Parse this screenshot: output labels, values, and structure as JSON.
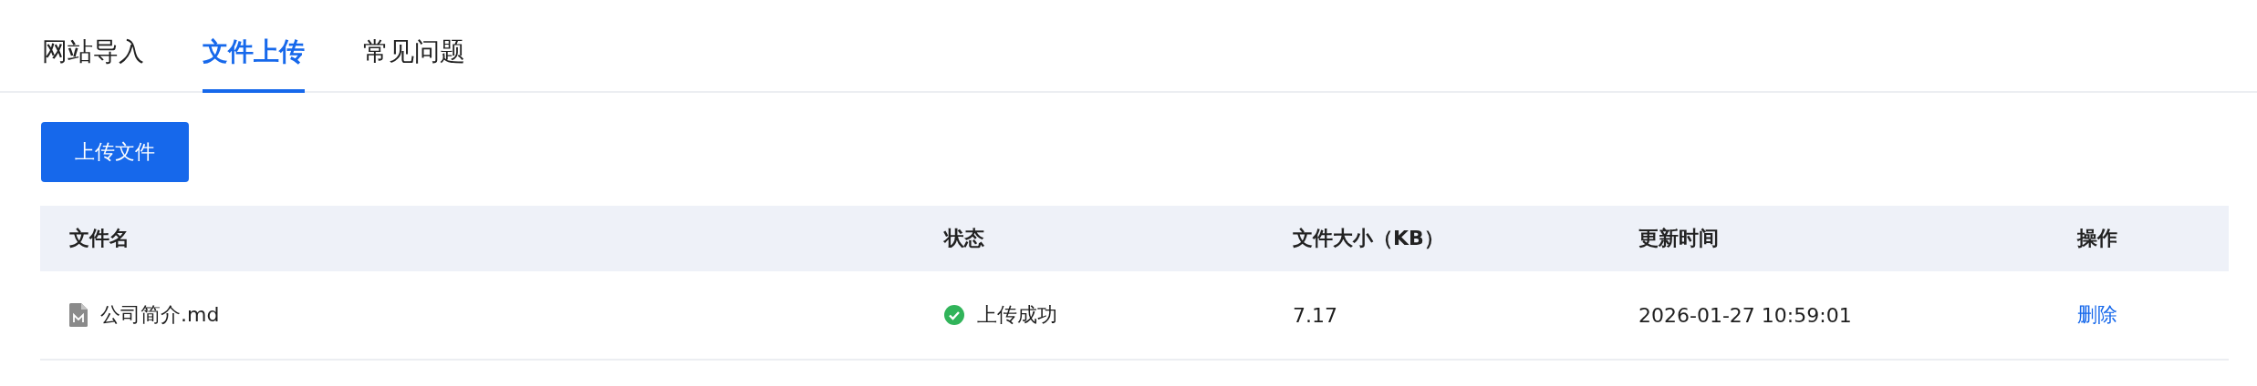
{
  "tabs": [
    {
      "label": "网站导入",
      "selected": false
    },
    {
      "label": "文件上传",
      "selected": true
    },
    {
      "label": "常见问题",
      "selected": false
    }
  ],
  "upload_button": "上传文件",
  "table": {
    "columns": [
      "文件名",
      "状态",
      "文件大小（KB）",
      "更新时间",
      "操作"
    ],
    "rows": [
      {
        "file_name": "公司简介.md",
        "status": {
          "kind": "success",
          "label": "上传成功"
        },
        "size": "7.17",
        "updated": "2026-01-27 10:59:01",
        "action": "删除"
      }
    ]
  }
}
